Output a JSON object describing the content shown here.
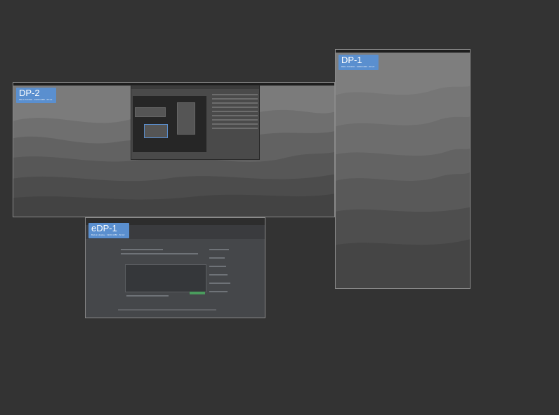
{
  "displays": [
    {
      "id": "dp2",
      "name": "DP-2",
      "resolution_text": "DELL P2419H · 1920×1080 · 60 Hz"
    },
    {
      "id": "dp1",
      "name": "DP-1",
      "resolution_text": "DELL P2419H · 1080×1920 · 60 Hz"
    },
    {
      "id": "edp1",
      "name": "eDP-1",
      "resolution_text": "Built-in display · 1920×1080 · 60 Hz"
    }
  ],
  "colors": {
    "background": "#333333",
    "label_bg": "#5a8fcf",
    "border": "#8a8a8a"
  }
}
